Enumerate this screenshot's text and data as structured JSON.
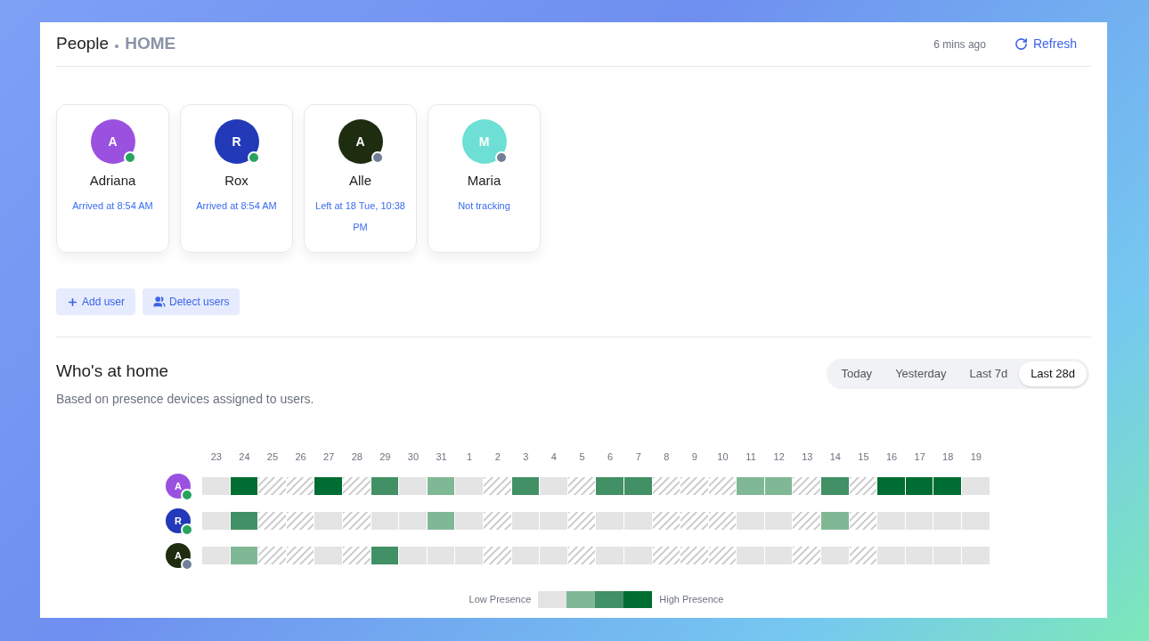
{
  "header": {
    "title": "People",
    "subtitle": "HOME",
    "updated": "6 mins ago",
    "refresh": "Refresh"
  },
  "users": [
    {
      "initial": "A",
      "name": "Adriana",
      "status": "Arrived at 8:54 AM",
      "color": "#9b51e0",
      "present": true
    },
    {
      "initial": "R",
      "name": "Rox",
      "status": "Arrived at 8:54 AM",
      "color": "#2239b8",
      "present": true
    },
    {
      "initial": "A",
      "name": "Alle",
      "status": "Left at 18 Tue, 10:38 PM",
      "color": "#1e2c10",
      "present": false
    },
    {
      "initial": "M",
      "name": "Maria",
      "status": "Not tracking",
      "color": "#6ddfd4",
      "present": false
    }
  ],
  "actions": [
    {
      "kind": "add",
      "label": "Add user"
    },
    {
      "kind": "detect",
      "label": "Detect users"
    }
  ],
  "presence": {
    "title": "Who's at home",
    "subtitle": "Based on presence devices assigned to users.",
    "ranges": [
      {
        "label": "Today",
        "selected": false
      },
      {
        "label": "Yesterday",
        "selected": false
      },
      {
        "label": "Last 7d",
        "selected": false
      },
      {
        "label": "Last 28d",
        "selected": true
      }
    ],
    "days": [
      "23",
      "24",
      "25",
      "26",
      "27",
      "28",
      "29",
      "30",
      "31",
      "1",
      "2",
      "3",
      "4",
      "5",
      "6",
      "7",
      "8",
      "9",
      "10",
      "11",
      "12",
      "13",
      "14",
      "15",
      "16",
      "17",
      "18",
      "19"
    ],
    "rows": [
      {
        "initial": "A",
        "color": "#9b51e0",
        "present": true,
        "cells": [
          {
            "kind": "empty"
          },
          {
            "kind": "high"
          },
          {
            "kind": "no-data"
          },
          {
            "kind": "no-data"
          },
          {
            "kind": "high"
          },
          {
            "kind": "no-data"
          },
          {
            "kind": "mid"
          },
          {
            "kind": "empty"
          },
          {
            "kind": "low"
          },
          {
            "kind": "empty"
          },
          {
            "kind": "no-data"
          },
          {
            "kind": "mid"
          },
          {
            "kind": "empty"
          },
          {
            "kind": "no-data"
          },
          {
            "kind": "mid"
          },
          {
            "kind": "mid"
          },
          {
            "kind": "no-data"
          },
          {
            "kind": "no-data"
          },
          {
            "kind": "no-data"
          },
          {
            "kind": "low"
          },
          {
            "kind": "low"
          },
          {
            "kind": "no-data"
          },
          {
            "kind": "mid"
          },
          {
            "kind": "no-data"
          },
          {
            "kind": "high"
          },
          {
            "kind": "high"
          },
          {
            "kind": "high"
          },
          {
            "kind": "empty"
          }
        ]
      },
      {
        "initial": "R",
        "color": "#2239b8",
        "present": true,
        "cells": [
          {
            "kind": "empty"
          },
          {
            "kind": "mid"
          },
          {
            "kind": "no-data"
          },
          {
            "kind": "no-data"
          },
          {
            "kind": "empty"
          },
          {
            "kind": "no-data"
          },
          {
            "kind": "empty"
          },
          {
            "kind": "empty"
          },
          {
            "kind": "low"
          },
          {
            "kind": "empty"
          },
          {
            "kind": "no-data"
          },
          {
            "kind": "empty"
          },
          {
            "kind": "empty"
          },
          {
            "kind": "no-data"
          },
          {
            "kind": "empty"
          },
          {
            "kind": "empty"
          },
          {
            "kind": "no-data"
          },
          {
            "kind": "no-data"
          },
          {
            "kind": "no-data"
          },
          {
            "kind": "empty"
          },
          {
            "kind": "empty"
          },
          {
            "kind": "no-data"
          },
          {
            "kind": "low"
          },
          {
            "kind": "no-data"
          },
          {
            "kind": "empty"
          },
          {
            "kind": "empty"
          },
          {
            "kind": "empty"
          },
          {
            "kind": "empty"
          }
        ]
      },
      {
        "initial": "A",
        "color": "#1e2c10",
        "present": false,
        "cells": [
          {
            "kind": "empty"
          },
          {
            "kind": "low"
          },
          {
            "kind": "no-data"
          },
          {
            "kind": "no-data"
          },
          {
            "kind": "empty"
          },
          {
            "kind": "no-data"
          },
          {
            "kind": "mid"
          },
          {
            "kind": "empty"
          },
          {
            "kind": "empty"
          },
          {
            "kind": "empty"
          },
          {
            "kind": "no-data"
          },
          {
            "kind": "empty"
          },
          {
            "kind": "empty"
          },
          {
            "kind": "no-data"
          },
          {
            "kind": "empty"
          },
          {
            "kind": "empty"
          },
          {
            "kind": "no-data"
          },
          {
            "kind": "no-data"
          },
          {
            "kind": "no-data"
          },
          {
            "kind": "empty"
          },
          {
            "kind": "empty"
          },
          {
            "kind": "no-data"
          },
          {
            "kind": "empty"
          },
          {
            "kind": "no-data"
          },
          {
            "kind": "empty"
          },
          {
            "kind": "empty"
          },
          {
            "kind": "empty"
          },
          {
            "kind": "empty"
          }
        ]
      }
    ],
    "legend": {
      "low": "Low Presence",
      "high": "High Presence",
      "steps": [
        {
          "kind": "empty"
        },
        {
          "kind": "low"
        },
        {
          "kind": "mid"
        },
        {
          "kind": "high"
        }
      ]
    }
  }
}
